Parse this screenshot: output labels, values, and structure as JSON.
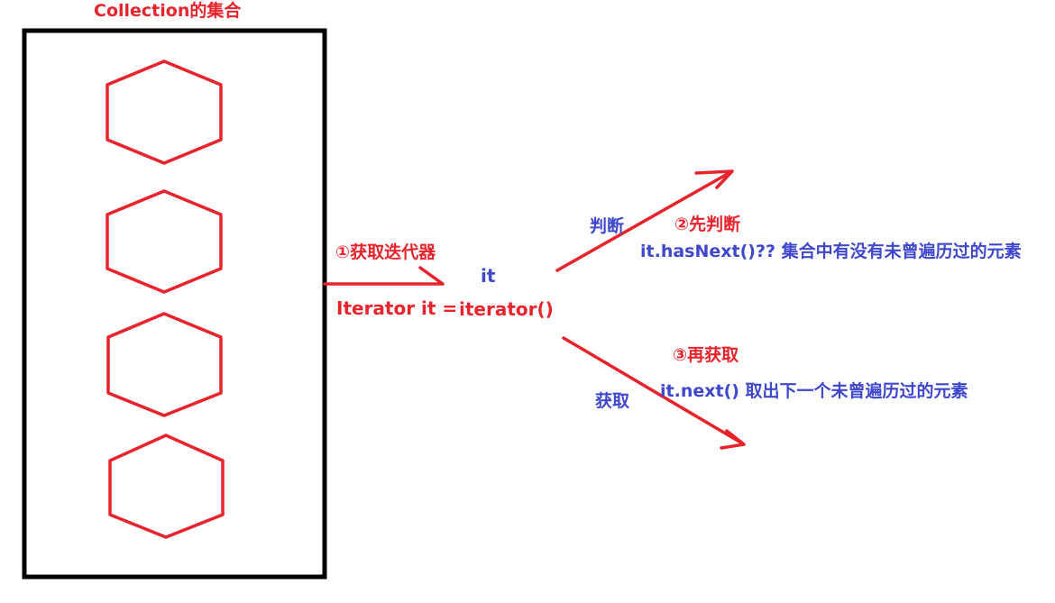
{
  "colors": {
    "pen_red": "#e8232b",
    "pen_blue": "#3f48cc",
    "box_black": "#000000",
    "background": "#ffffff"
  },
  "collection": {
    "title": "Collection的集合",
    "element_count": 4
  },
  "step1": {
    "label": "①获取迭代器",
    "variable": "it",
    "code_left": "Iterator it =",
    "code_right": "iterator()"
  },
  "step2": {
    "action": "判断",
    "label": "②先判断",
    "code": "it.hasNext()?? 集合中有没有未曾遍历过的元素"
  },
  "step3": {
    "action": "获取",
    "label": "③再获取",
    "code": "it.next()  取出下一个未曾遍历过的元素"
  }
}
